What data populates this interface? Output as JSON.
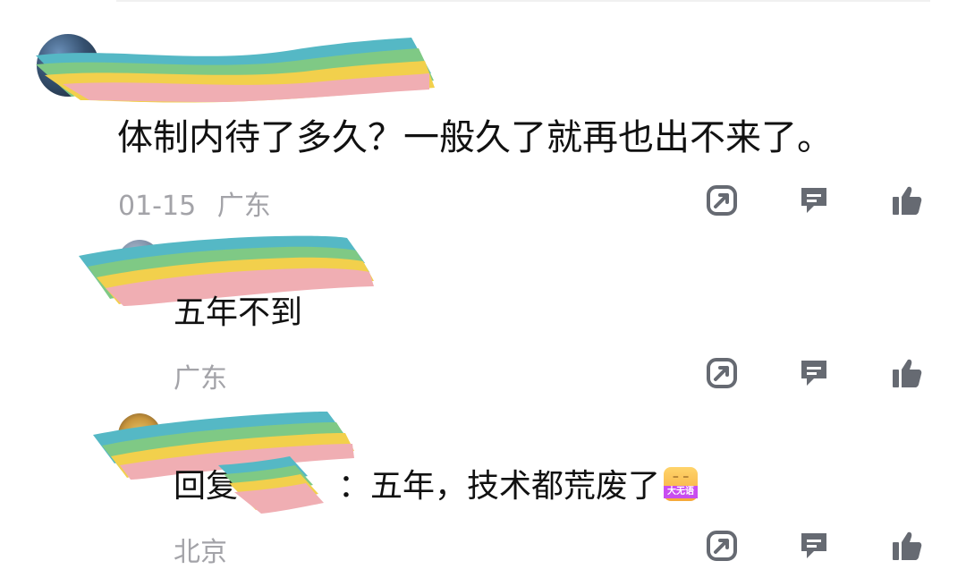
{
  "comments": [
    {
      "text": "体制内待了多久？一般久了就再也出不来了。",
      "date": "01-15",
      "location": "广东"
    }
  ],
  "replies": [
    {
      "text": "五年不到",
      "location": "广东"
    },
    {
      "prefix": "回复",
      "colon": "：",
      "text": "五年，技术都荒废了",
      "emoji_label": "大无语",
      "location": "北京"
    }
  ],
  "icons": {
    "share": "share-icon",
    "reply": "comment-icon",
    "like": "thumbs-up-icon"
  },
  "colors": {
    "icon": "#666a72",
    "meta": "#a3a3a8"
  }
}
